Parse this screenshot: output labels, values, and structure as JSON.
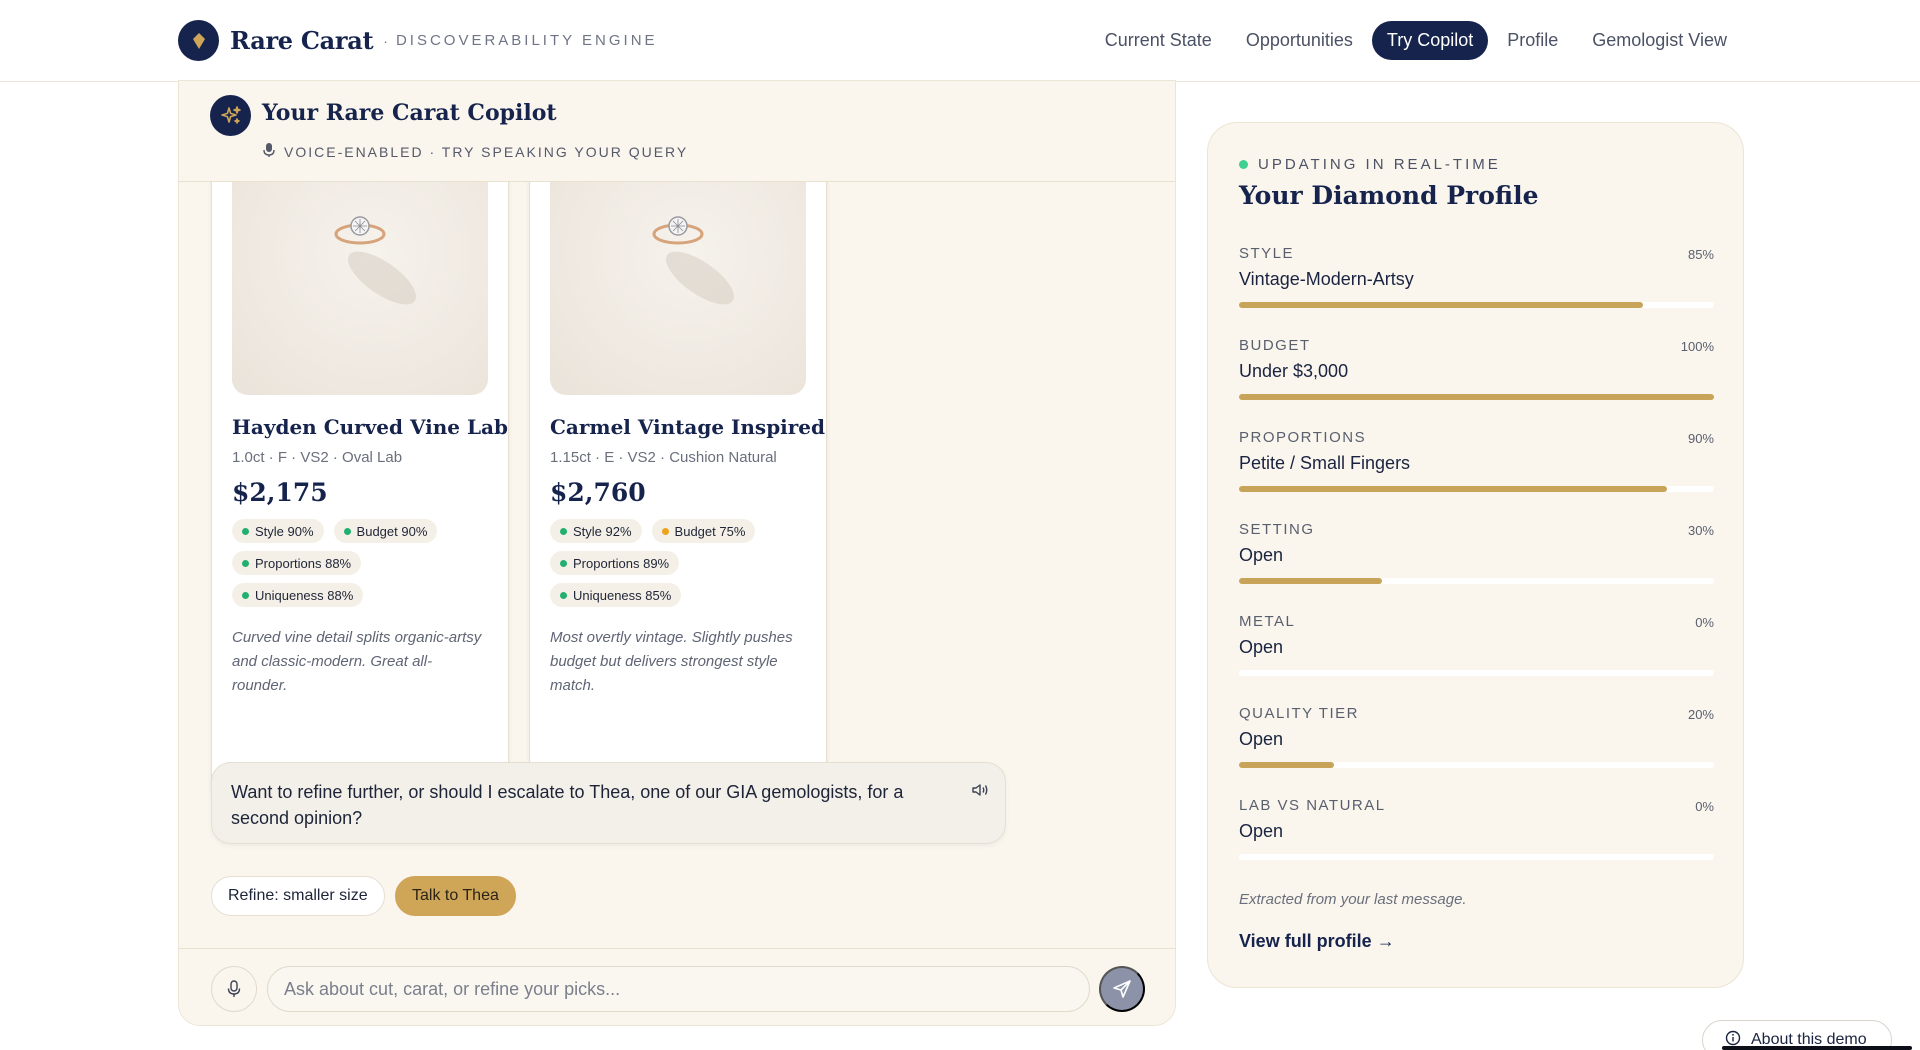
{
  "brand": {
    "name": "Rare Carat",
    "separator": "·",
    "subtitle": "DISCOVERABILITY ENGINE",
    "logo_icon": "diamond-icon"
  },
  "nav": [
    {
      "label": "Current State",
      "active": false
    },
    {
      "label": "Opportunities",
      "active": false
    },
    {
      "label": "Try Copilot",
      "active": true
    },
    {
      "label": "Profile",
      "active": false
    },
    {
      "label": "Gemologist View",
      "active": false
    }
  ],
  "chat": {
    "title": "Your Rare Carat Copilot",
    "subtitle": "VOICE-ENABLED · TRY SPEAKING YOUR QUERY",
    "title_icon": "sparkles-icon",
    "subtitle_icon": "microphone-icon",
    "cards": [
      {
        "name": "Hayden Curved Vine Lab",
        "spec": "1.0ct · F · VS2 · Oval Lab",
        "price": "$2,175",
        "chips": [
          {
            "label": "Style 90%",
            "status": "green"
          },
          {
            "label": "Budget 90%",
            "status": "green"
          },
          {
            "label": "Proportions 88%",
            "status": "green"
          },
          {
            "label": "Uniqueness 88%",
            "status": "green"
          }
        ],
        "note": "Curved vine detail splits organic-artsy and classic-modern. Great all-rounder."
      },
      {
        "name": "Carmel Vintage Inspired",
        "spec": "1.15ct · E · VS2 · Cushion Natural",
        "price": "$2,760",
        "chips": [
          {
            "label": "Style 92%",
            "status": "green"
          },
          {
            "label": "Budget 75%",
            "status": "orange"
          },
          {
            "label": "Proportions 89%",
            "status": "green"
          },
          {
            "label": "Uniqueness 85%",
            "status": "green"
          }
        ],
        "note": "Most overtly vintage. Slightly pushes budget but delivers strongest style match."
      }
    ],
    "message": "Want to refine further, or should I escalate to Thea, one of our GIA gemologists, for a second opinion?",
    "quick_replies": [
      "Refine: smaller size",
      "Talk to Thea"
    ],
    "input": {
      "value": "",
      "placeholder": "Ask about cut, carat, or refine your picks..."
    }
  },
  "profile": {
    "status": "UPDATING IN REAL-TIME",
    "title": "Your Diamond Profile",
    "attributes": [
      {
        "label": "STYLE",
        "value": "Vintage-Modern-Artsy",
        "pct_label": "85%",
        "fill": 0.85
      },
      {
        "label": "BUDGET",
        "value": "Under $3,000",
        "pct_label": "100%",
        "fill": 1.0
      },
      {
        "label": "PROPORTIONS",
        "value": "Petite / Small Fingers",
        "pct_label": "90%",
        "fill": 0.9
      },
      {
        "label": "SETTING",
        "value": "Open",
        "pct_label": "30%",
        "fill": 0.3
      },
      {
        "label": "METAL",
        "value": "Open",
        "pct_label": "0%",
        "fill": 0.0
      },
      {
        "label": "QUALITY TIER",
        "value": "Open",
        "pct_label": "20%",
        "fill": 0.2
      },
      {
        "label": "LAB VS NATURAL",
        "value": "Open",
        "pct_label": "0%",
        "fill": 0.0
      }
    ],
    "extracted_note": "Extracted from your last message.",
    "full_profile_link": "View full profile →"
  },
  "about": {
    "label": "About this demo",
    "icon": "info-icon"
  },
  "colors": {
    "navy": "#16244d",
    "gold": "#cfa558",
    "bar": "#c8a45a",
    "cream": "#faf6ee",
    "green": "#22b06f",
    "orange": "#eea21a"
  }
}
